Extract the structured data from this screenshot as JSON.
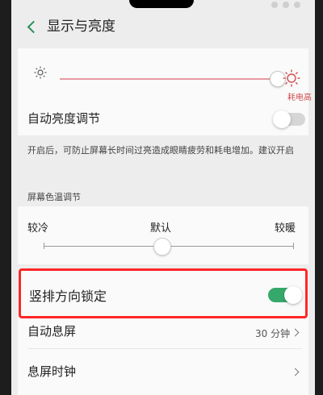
{
  "header": {
    "title": "显示与亮度"
  },
  "brightness": {
    "power_label": "耗电高"
  },
  "auto_brightness": {
    "label": "自动亮度调节",
    "enabled": false
  },
  "hint": {
    "text": "开启后，可防止屏幕长时间过亮造成眼睛疲劳和耗电增加。建议开启"
  },
  "color_temp": {
    "section_title": "屏幕色温调节",
    "cold_label": "较冷",
    "default_label": "默认",
    "warm_label": "较暖"
  },
  "portrait_lock": {
    "label": "竖排方向锁定",
    "enabled": true
  },
  "auto_screen_off": {
    "label": "自动息屏",
    "value": "30 分钟"
  },
  "screen_off_clock": {
    "label": "息屏时钟"
  },
  "colors": {
    "accent": "#37a86b",
    "warning": "#d24c4c",
    "highlight": "#ff2626"
  }
}
